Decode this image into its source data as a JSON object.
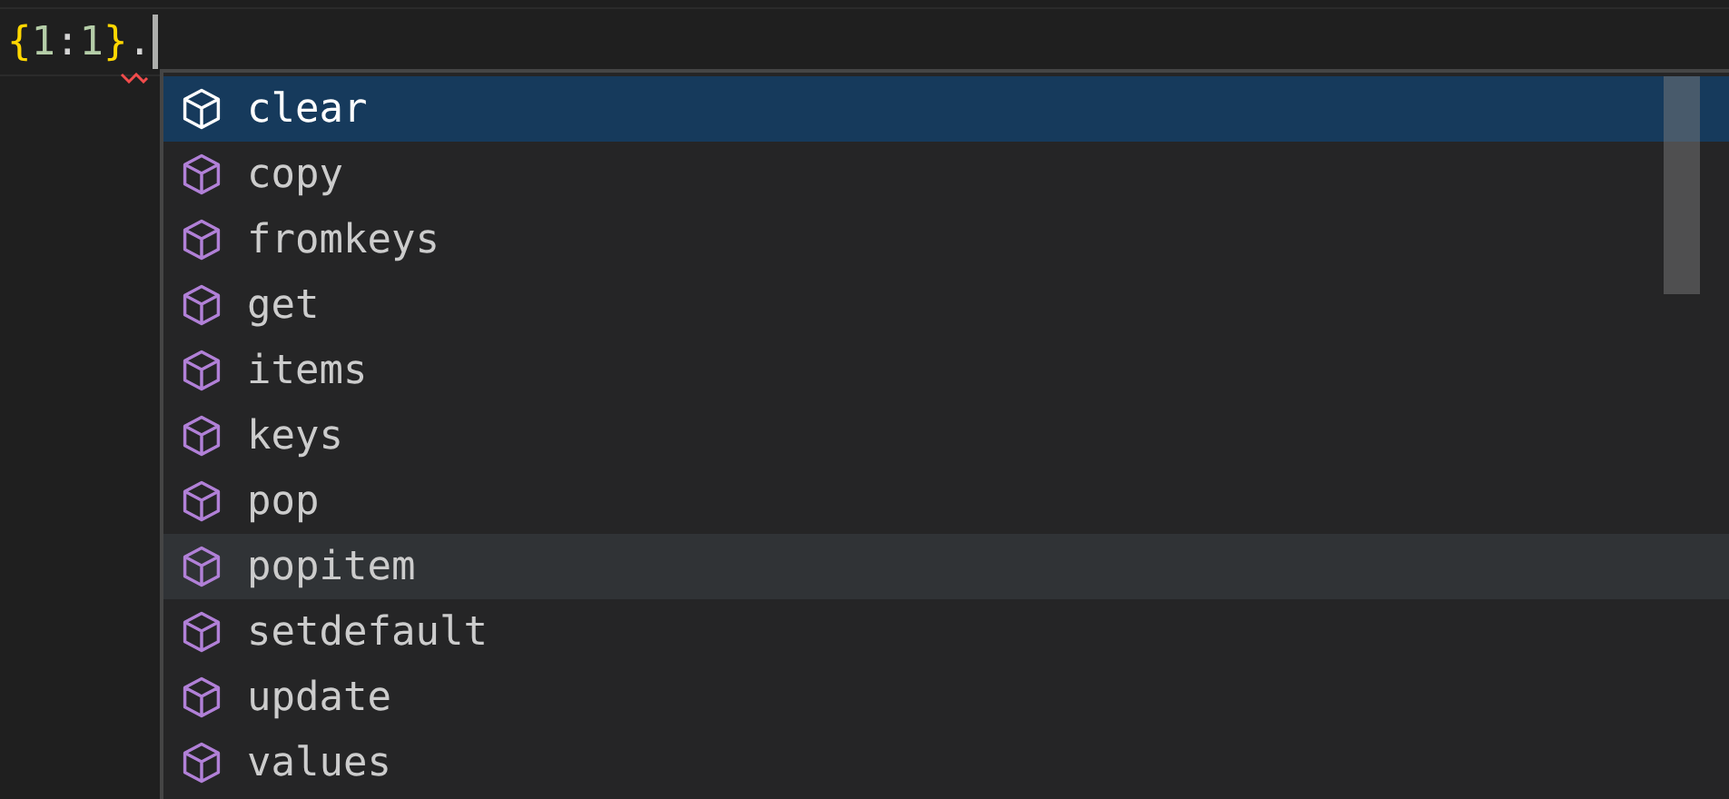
{
  "editor": {
    "tokens": [
      {
        "text": "{",
        "kind": "brace"
      },
      {
        "text": "1",
        "kind": "number"
      },
      {
        "text": ":",
        "kind": "punct"
      },
      {
        "text": "1",
        "kind": "number"
      },
      {
        "text": "}",
        "kind": "brace"
      },
      {
        "text": ".",
        "kind": "punct"
      }
    ],
    "error_under_last": true
  },
  "suggestions": [
    {
      "label": "clear",
      "selected": true,
      "hovered": false
    },
    {
      "label": "copy",
      "selected": false,
      "hovered": false
    },
    {
      "label": "fromkeys",
      "selected": false,
      "hovered": false
    },
    {
      "label": "get",
      "selected": false,
      "hovered": false
    },
    {
      "label": "items",
      "selected": false,
      "hovered": false
    },
    {
      "label": "keys",
      "selected": false,
      "hovered": false
    },
    {
      "label": "pop",
      "selected": false,
      "hovered": false
    },
    {
      "label": "popitem",
      "selected": false,
      "hovered": true
    },
    {
      "label": "setdefault",
      "selected": false,
      "hovered": false
    },
    {
      "label": "update",
      "selected": false,
      "hovered": false
    },
    {
      "label": "values",
      "selected": false,
      "hovered": false
    }
  ]
}
